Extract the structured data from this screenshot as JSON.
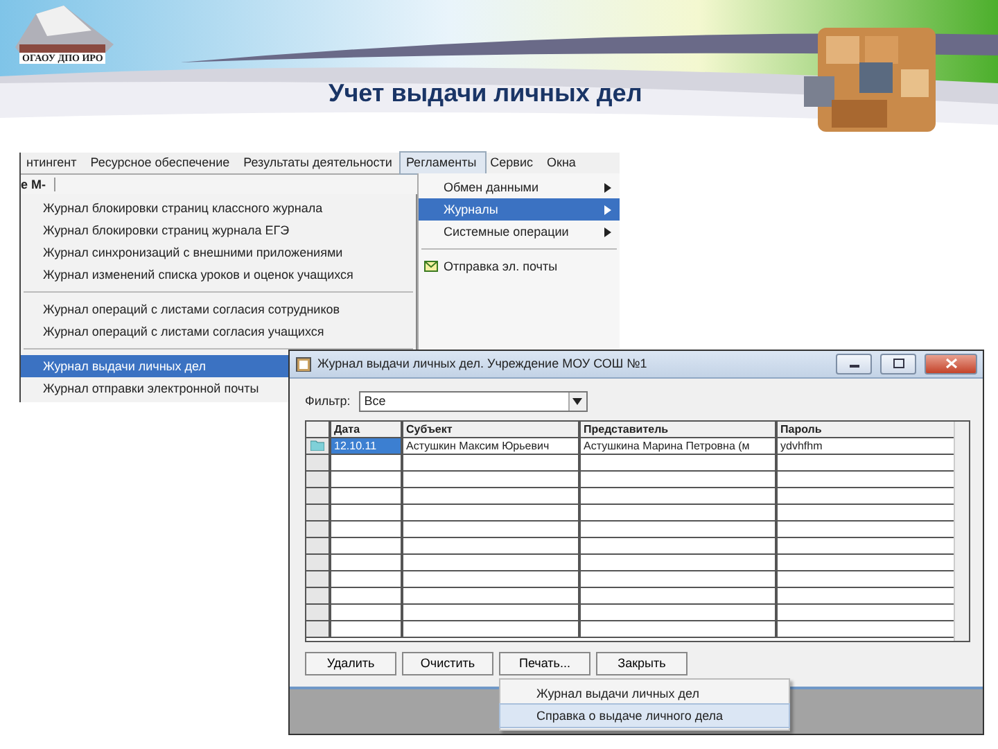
{
  "slide": {
    "logo": "ОГАОУ ДПО ИРО",
    "title": "Учет выдачи личных дел"
  },
  "app": {
    "menu": [
      {
        "label": "нтингент",
        "selected": false
      },
      {
        "label": "Ресурсное обеспечение",
        "selected": false
      },
      {
        "label": "Результаты деятельности",
        "selected": false
      },
      {
        "label": "Регламенты",
        "selected": true
      },
      {
        "label": "Сервис",
        "selected": false
      },
      {
        "label": "Окна",
        "selected": false
      }
    ],
    "fragment": "е М-",
    "service_menu": [
      [
        {
          "label": "Обмен данными",
          "kind": "submenu",
          "selected": false
        },
        {
          "label": "Журналы",
          "kind": "submenu",
          "selected": true
        },
        {
          "label": "Системные операции",
          "kind": "submenu",
          "selected": false
        }
      ],
      [
        {
          "label": "Отправка эл. почты",
          "kind": "mail",
          "selected": false
        }
      ]
    ],
    "journals_menu": [
      [
        {
          "label": "Журнал блокировки страниц классного журнала",
          "selected": false
        },
        {
          "label": "Журнал блокировки страниц журнала ЕГЭ",
          "selected": false
        },
        {
          "label": "Журнал синхронизаций с внешними приложениями",
          "selected": false
        },
        {
          "label": "Журнал изменений списка уроков и оценок учащихся",
          "selected": false
        }
      ],
      [
        {
          "label": "Журнал операций с листами согласия сотрудников",
          "selected": false
        },
        {
          "label": "Журнал операций с листами согласия учащихся",
          "selected": false
        }
      ],
      [
        {
          "label": "Журнал выдачи личных дел",
          "selected": true
        },
        {
          "label": "Журнал отправки электронной почты",
          "selected": false
        }
      ]
    ]
  },
  "dialog": {
    "title": "Журнал выдачи личных дел. Учреждение МОУ СОШ №1",
    "filter_label": "Фильтр:",
    "filter_value": "Все",
    "columns": [
      "Дата",
      "Субъект",
      "Представитель",
      "Пароль"
    ],
    "rows": [
      {
        "cells": [
          "12.10.11",
          "Астушкин Максим Юрьевич",
          "Астушкина Марина Петровна (м",
          "ydvhfhm"
        ],
        "selected": true
      }
    ],
    "buttons": [
      "Удалить",
      "Очистить",
      "Печать...",
      "Закрыть"
    ],
    "print_menu": [
      {
        "label": "Журнал выдачи личных дел",
        "selected": false
      },
      {
        "label": "Справка о выдаче личного дела",
        "selected": true
      }
    ]
  }
}
